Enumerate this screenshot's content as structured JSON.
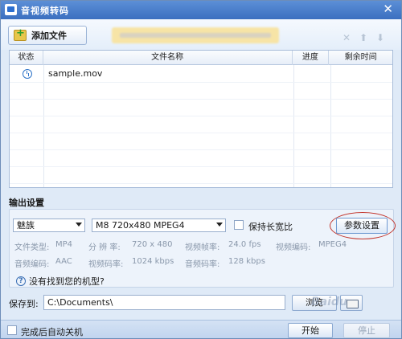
{
  "window": {
    "title": "音视频转码",
    "close_glyph": "✕"
  },
  "toolbar": {
    "add_file_label": "添加文件",
    "icons": [
      "close-icon",
      "arrow-up-icon",
      "arrow-down-icon"
    ]
  },
  "file_list": {
    "columns": [
      "状态",
      "文件名称",
      "进度",
      "剩余时间"
    ],
    "rows": [
      {
        "status_icon": "clock-icon",
        "name": "sample.mov",
        "progress": "",
        "remaining": ""
      }
    ]
  },
  "output": {
    "section_label": "输出设置",
    "brand": "魅族",
    "model": "M8 720x480 MPEG4",
    "keep_ratio_label": "保持长宽比",
    "param_button": "参数设置",
    "info": {
      "file_type_label": "文件类型:",
      "file_type": "MP4",
      "resolution_label": "分 辨 率:",
      "resolution": "720 x 480",
      "video_fps_label": "视频帧率:",
      "video_fps": "24.0 fps",
      "video_codec_label": "视频编码:",
      "video_codec": "MPEG4",
      "audio_codec_label": "音频编码:",
      "audio_codec": "AAC",
      "video_bitrate_label": "视频码率:",
      "video_bitrate": "1024 kbps",
      "audio_bitrate_label": "音频码率:",
      "audio_bitrate": "128 kbps"
    },
    "help_text": "没有找到您的机型?"
  },
  "save": {
    "label": "保存到:",
    "path": "C:\\Documents\\",
    "browse_label": "浏览"
  },
  "bottom": {
    "auto_shutdown_label": "完成后自动关机",
    "start_label": "开始",
    "stop_label": "停止"
  },
  "watermark": "Baidu"
}
